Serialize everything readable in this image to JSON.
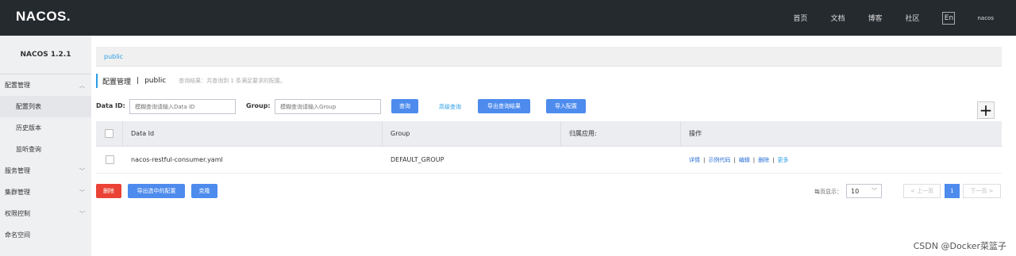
{
  "topbar": {
    "logo": "NACOS.",
    "nav": [
      "首页",
      "文档",
      "博客",
      "社区"
    ],
    "lang": "En",
    "user": "nacos"
  },
  "sidebar": {
    "version": "NACOS 1.2.1",
    "items": [
      {
        "label": "配置管理",
        "chevron": "︿"
      },
      {
        "label": "配置列表"
      },
      {
        "label": "历史版本"
      },
      {
        "label": "监听查询"
      },
      {
        "label": "服务管理",
        "chevron": "﹀"
      },
      {
        "label": "集群管理",
        "chevron": "﹀"
      },
      {
        "label": "权限控制",
        "chevron": "﹀"
      },
      {
        "label": "命名空间"
      }
    ]
  },
  "namespace": {
    "active": "public"
  },
  "page": {
    "title": "配置管理",
    "separator": "|",
    "namespace": "public",
    "hint": "查询结果：共查询到 1 条满足要求的配置。"
  },
  "search": {
    "data_id_label": "Data ID:",
    "data_id_placeholder": "模糊查询请输入Data ID",
    "group_label": "Group:",
    "group_placeholder": "模糊查询请输入Group",
    "query_button": "查询",
    "advanced_link": "高级查询",
    "export_result_button": "导出查询结果",
    "import_button": "导入配置",
    "add_button": "+"
  },
  "table": {
    "headers": [
      "Data Id",
      "Group",
      "归属应用:",
      "操作"
    ],
    "rows": [
      {
        "data_id": "nacos-restful-consumer.yaml",
        "group": "DEFAULT_GROUP",
        "app": ""
      }
    ],
    "ops": [
      "详情",
      "示例代码",
      "编辑",
      "删除",
      "更多"
    ],
    "op_separator": "|"
  },
  "actions": {
    "delete": "删除",
    "export_selected": "导出选中的配置",
    "clone": "克隆"
  },
  "pagination": {
    "page_size_label": "每页显示：",
    "page_size": "10",
    "prev": "< 上一页",
    "current": "1",
    "next": "下一页 >"
  },
  "watermark": "CSDN @Docker菜篮子",
  "colors": {
    "topbar": "#252a2f",
    "primary": "#4d8bed",
    "danger": "#ea4335",
    "link": "#2a9de6"
  }
}
